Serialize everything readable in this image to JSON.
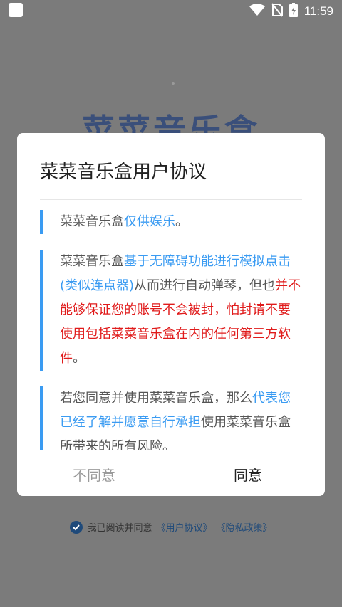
{
  "status_bar": {
    "time": "11:59",
    "icons": [
      "wifi-icon",
      "no-sim-icon",
      "battery-charging-icon"
    ]
  },
  "background": {
    "app_title": "菜菜音乐盒"
  },
  "dialog": {
    "title": "菜菜音乐盒用户协议",
    "paragraphs": {
      "p1": {
        "normal1": "菜菜音乐盒",
        "blue1": "仅供娱乐",
        "normal2": "。"
      },
      "p2": {
        "normal1": "菜菜音乐盒",
        "blue1": "基于无障碍功能进行模拟点击(类似连点器)",
        "normal2": "从而进行自动弹琴，但也",
        "red1": "并不能够保证您的账号不会被封，怕封请不要使用包括菜菜音乐盒在内的任何第三方软件",
        "normal3": "。"
      },
      "p3": {
        "normal1": "若您同意并使用菜菜音乐盒，那么",
        "blue1": "代表您已经了解并愿意自行承担",
        "normal2": "使用菜菜音乐盒所带来的所有风险。"
      }
    },
    "buttons": {
      "disagree": "不同意",
      "agree": "同意"
    }
  },
  "footer": {
    "text": "我已阅读并同意",
    "user_agreement": "《用户协议》",
    "privacy_policy": "《隐私政策》",
    "checked": true
  },
  "colors": {
    "accent_blue": "#3a9bf2",
    "warning_red": "#e01b1b",
    "footer_link": "#1f4a7a"
  }
}
